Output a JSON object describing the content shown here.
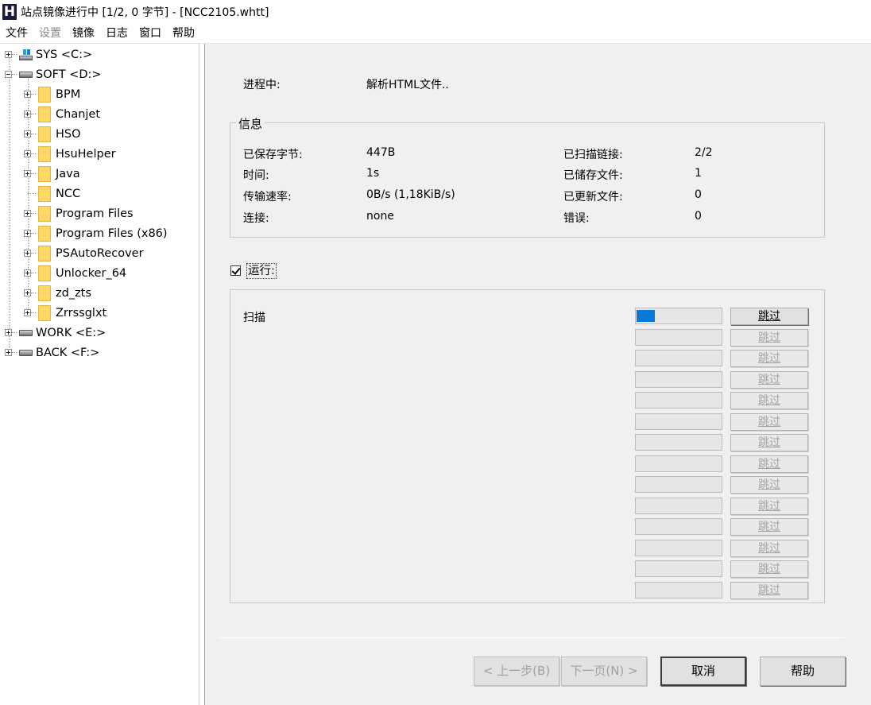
{
  "window": {
    "icon_glyph": "H",
    "title": "站点镜像进行中 [1/2, 0 字节] - [NCC2105.whtt]"
  },
  "menu": [
    "文件",
    "设置",
    "镜像",
    "日志",
    "窗口",
    "帮助"
  ],
  "menu_disabled": [
    "设置"
  ],
  "tree": {
    "drives": [
      {
        "label": "SYS <C:>",
        "expanded": false,
        "icon": "system-drive-icon"
      },
      {
        "label": "SOFT <D:>",
        "expanded": true,
        "icon": "drive-icon"
      },
      {
        "label": "WORK <E:>",
        "expanded": false,
        "icon": "drive-icon"
      },
      {
        "label": "BACK <F:>",
        "expanded": false,
        "icon": "drive-icon"
      }
    ],
    "folders": [
      {
        "label": "BPM",
        "expandable": true
      },
      {
        "label": "Chanjet",
        "expandable": true
      },
      {
        "label": "HSO",
        "expandable": true
      },
      {
        "label": "HsuHelper",
        "expandable": true
      },
      {
        "label": "Java",
        "expandable": true
      },
      {
        "label": "NCC",
        "expandable": false
      },
      {
        "label": "Program Files",
        "expandable": true
      },
      {
        "label": "Program Files (x86)",
        "expandable": true
      },
      {
        "label": "PSAutoRecover",
        "expandable": true
      },
      {
        "label": "Unlocker_64",
        "expandable": true
      },
      {
        "label": "zd_zts",
        "expandable": true
      },
      {
        "label": "Zrrssglxt",
        "expandable": true
      }
    ]
  },
  "progress": {
    "label": "进程中:",
    "value": "解析HTML文件.."
  },
  "info": {
    "title": "信息",
    "left": [
      {
        "label": "已保存字节:",
        "value": "447B"
      },
      {
        "label": "时间:",
        "value": "1s"
      },
      {
        "label": "传输速率:",
        "value": "0B/s (1,18KiB/s)"
      },
      {
        "label": "连接:",
        "value": "none"
      }
    ],
    "right": [
      {
        "label": "已扫描链接:",
        "value": "2/2"
      },
      {
        "label": "已储存文件:",
        "value": "1"
      },
      {
        "label": "已更新文件:",
        "value": "0"
      },
      {
        "label": "错误:",
        "value": "0"
      }
    ]
  },
  "run": {
    "label": "运行:",
    "checked": true
  },
  "scan": {
    "label": "扫描",
    "skip_label": "跳过",
    "rows": [
      {
        "fill": 0.21,
        "enabled": true
      },
      {
        "fill": 0,
        "enabled": false
      },
      {
        "fill": 0,
        "enabled": false
      },
      {
        "fill": 0,
        "enabled": false
      },
      {
        "fill": 0,
        "enabled": false
      },
      {
        "fill": 0,
        "enabled": false
      },
      {
        "fill": 0,
        "enabled": false
      },
      {
        "fill": 0,
        "enabled": false
      },
      {
        "fill": 0,
        "enabled": false
      },
      {
        "fill": 0,
        "enabled": false
      },
      {
        "fill": 0,
        "enabled": false
      },
      {
        "fill": 0,
        "enabled": false
      },
      {
        "fill": 0,
        "enabled": false
      },
      {
        "fill": 0,
        "enabled": false
      }
    ]
  },
  "buttons": {
    "back": "< 上一步(B)",
    "next": "下一页(N) >",
    "cancel": "取消",
    "help": "帮助"
  },
  "colors": {
    "progress_fill": "#0a78d7",
    "panel_bg": "#f0f0f0",
    "folder": "#ffd766"
  }
}
